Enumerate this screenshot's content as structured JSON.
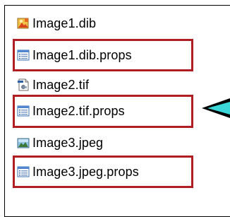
{
  "files": [
    {
      "name": "Image1.dib",
      "icon": "paint-image-icon",
      "highlighted": false
    },
    {
      "name": "Image1.dib.props",
      "icon": "props-file-icon",
      "highlighted": true
    },
    {
      "name": "Image2.tif",
      "icon": "tif-file-icon",
      "highlighted": false
    },
    {
      "name": "Image2.tif.props",
      "icon": "props-file-icon",
      "highlighted": true
    },
    {
      "name": "Image3.jpeg",
      "icon": "jpeg-image-icon",
      "highlighted": false
    },
    {
      "name": "Image3.jpeg.props",
      "icon": "props-file-icon",
      "highlighted": true
    }
  ],
  "colors": {
    "highlight_border": "#b01e24",
    "callout_fill": "#3ad6d8",
    "callout_outline": "#000000"
  }
}
